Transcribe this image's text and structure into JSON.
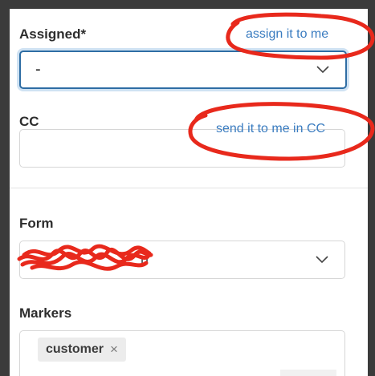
{
  "assigned": {
    "label": "Assigned*",
    "link": "assign it to me",
    "value": "-"
  },
  "cc": {
    "label": "CC",
    "link": "send it to me in CC",
    "value": ""
  },
  "form": {
    "label": "Form",
    "value_redacted": "redacted-scribble"
  },
  "markers": {
    "label": "Markers",
    "tags": [
      {
        "label": "customer",
        "remove_glyph": "×"
      }
    ]
  },
  "icons": {
    "select_chevron": "chevron-down-icon",
    "tag_remove": "close-icon"
  },
  "colors": {
    "link": "#3a7cc0",
    "focus_border": "#2e6da4",
    "annotation": "#e8291c",
    "background": "#3b3b3b"
  }
}
